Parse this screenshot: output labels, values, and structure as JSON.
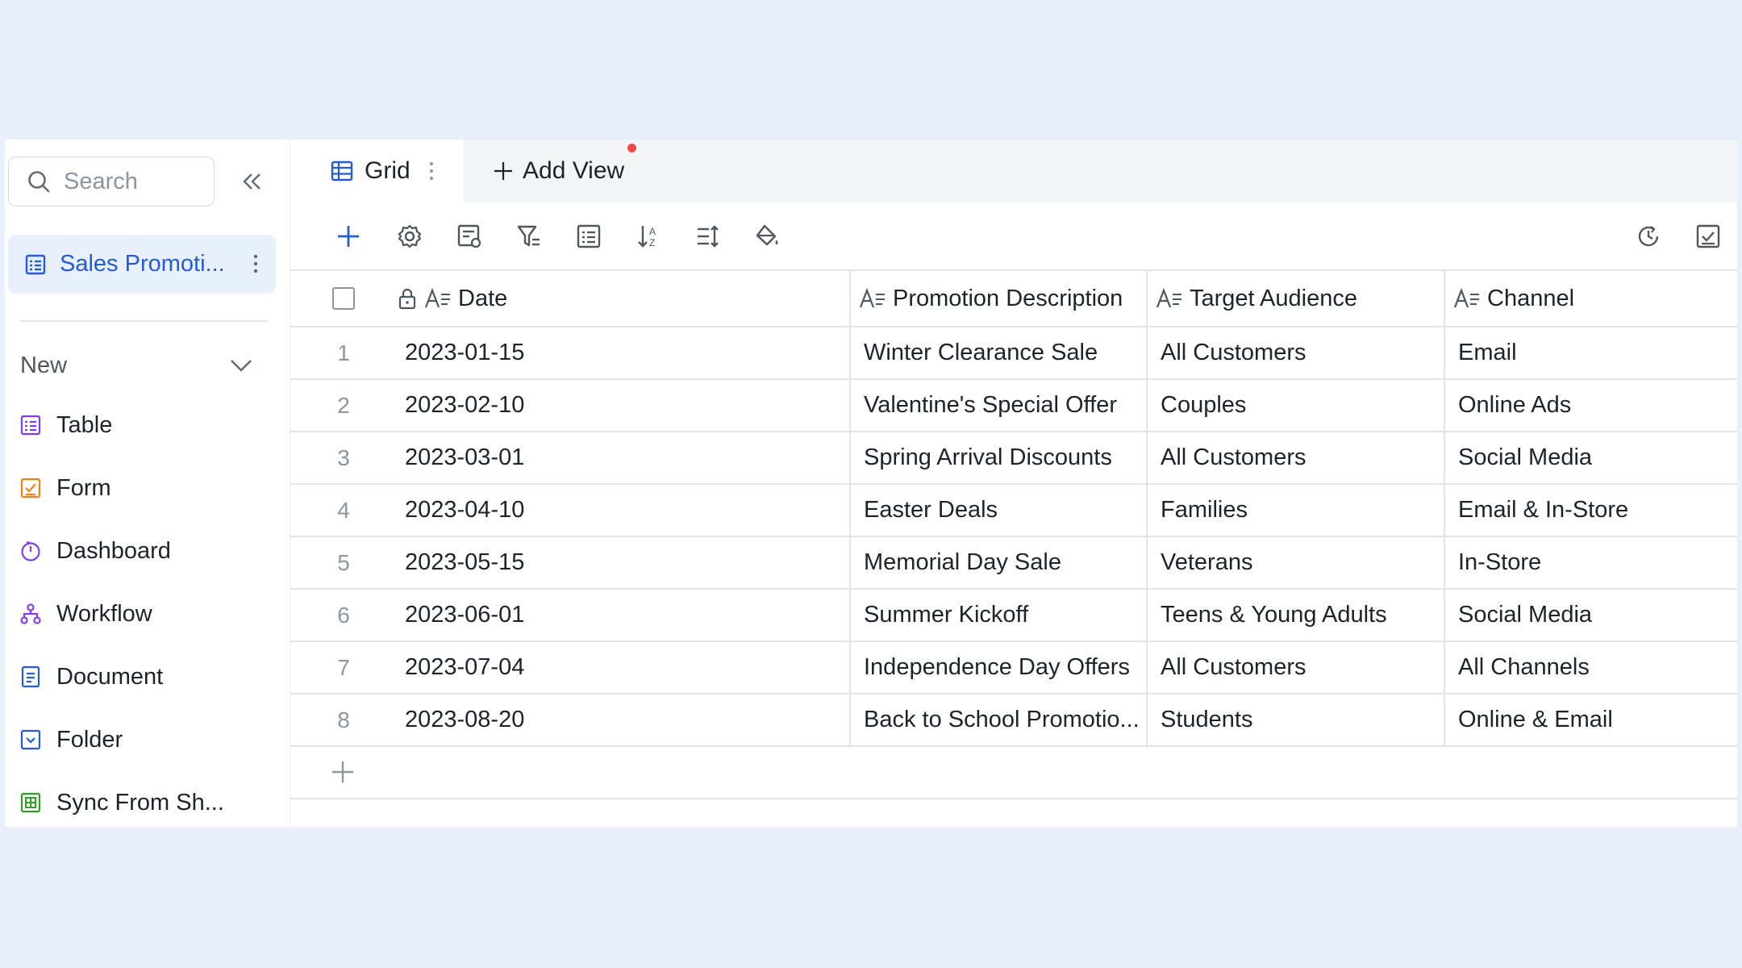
{
  "sidebar": {
    "search": {
      "placeholder": "Search"
    },
    "sheet": {
      "label": "Sales Promoti..."
    },
    "new_label": "New",
    "items": [
      {
        "label": "Table",
        "icon": "table-icon"
      },
      {
        "label": "Form",
        "icon": "form-icon"
      },
      {
        "label": "Dashboard",
        "icon": "dashboard-icon"
      },
      {
        "label": "Workflow",
        "icon": "workflow-icon"
      },
      {
        "label": "Document",
        "icon": "document-icon"
      },
      {
        "label": "Folder",
        "icon": "folder-icon"
      },
      {
        "label": "Sync From Sh...",
        "icon": "sync-sheet-icon"
      }
    ]
  },
  "tabs": {
    "grid_label": "Grid",
    "add_view_label": "Add View"
  },
  "table": {
    "headers": {
      "date": "Date",
      "description": "Promotion Description",
      "audience": "Target Audience",
      "channel": "Channel"
    },
    "rows": [
      {
        "idx": "1",
        "date": "2023-01-15",
        "description": "Winter Clearance Sale",
        "audience": "All Customers",
        "channel": "Email"
      },
      {
        "idx": "2",
        "date": "2023-02-10",
        "description": "Valentine's Special Offer",
        "audience": "Couples",
        "channel": "Online Ads"
      },
      {
        "idx": "3",
        "date": "2023-03-01",
        "description": "Spring Arrival Discounts",
        "audience": "All Customers",
        "channel": "Social Media"
      },
      {
        "idx": "4",
        "date": "2023-04-10",
        "description": "Easter Deals",
        "audience": "Families",
        "channel": "Email & In-Store"
      },
      {
        "idx": "5",
        "date": "2023-05-15",
        "description": "Memorial Day Sale",
        "audience": "Veterans",
        "channel": "In-Store"
      },
      {
        "idx": "6",
        "date": "2023-06-01",
        "description": "Summer Kickoff",
        "audience": "Teens & Young Adults",
        "channel": "Social Media"
      },
      {
        "idx": "7",
        "date": "2023-07-04",
        "description": "Independence Day Offers",
        "audience": "All Customers",
        "channel": "All Channels"
      },
      {
        "idx": "8",
        "date": "2023-08-20",
        "description": "Back to School Promotio...",
        "audience": "Students",
        "channel": "Online & Email"
      }
    ]
  },
  "colors": {
    "accent": "#245bdb",
    "selected_bg": "#e8effd",
    "page_bg": "#e9effd"
  }
}
